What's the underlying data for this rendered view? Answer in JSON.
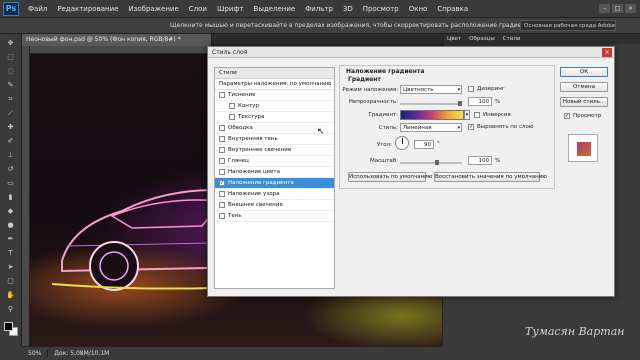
{
  "app": {
    "logo": "Ps"
  },
  "menu": [
    "Файл",
    "Редактирование",
    "Изображение",
    "Слои",
    "Шрифт",
    "Выделение",
    "Фильтр",
    "3D",
    "Просмотр",
    "Окно",
    "Справка"
  ],
  "window_controls": [
    "–",
    "□",
    "×"
  ],
  "optionsbar": {
    "hint": "Щелкните мышью и перетаскивайте в пределах изображения, чтобы скорректировать расположение градиента.",
    "workspace": "Основная рабочая среда Adobe Photoshop"
  },
  "document": {
    "tab": "Неоновый фон.psd @ 50% (Фон копия, RGB/8#) *"
  },
  "status": {
    "zoom": "50%",
    "doc": "Док: 5,08M/10,1M"
  },
  "right_panel": {
    "tabs": [
      "Цвет",
      "Образцы",
      "Стили"
    ]
  },
  "watermark": "Тумасян Вартан",
  "dialog": {
    "title": "Стиль слоя",
    "close": "×",
    "left_header": "Стили",
    "left_sub": "Параметры наложения: по умолчанию",
    "items": [
      {
        "label": "Тиснение",
        "checked": false,
        "sub": false
      },
      {
        "label": "Контур",
        "checked": false,
        "sub": true
      },
      {
        "label": "Текстура",
        "checked": false,
        "sub": true
      },
      {
        "label": "Обводка",
        "checked": false,
        "sub": false
      },
      {
        "label": "Внутренняя тень",
        "checked": false,
        "sub": false
      },
      {
        "label": "Внутреннее свечение",
        "checked": false,
        "sub": false
      },
      {
        "label": "Глянец",
        "checked": false,
        "sub": false
      },
      {
        "label": "Наложение цвета",
        "checked": false,
        "sub": false
      },
      {
        "label": "Наложение градиента",
        "checked": true,
        "sub": false,
        "selected": true
      },
      {
        "label": "Наложение узора",
        "checked": false,
        "sub": false
      },
      {
        "label": "Внешнее свечение",
        "checked": false,
        "sub": false
      },
      {
        "label": "Тень",
        "checked": false,
        "sub": false
      }
    ],
    "section_title": "Наложение градиента",
    "group_title": "Градиент",
    "blend_mode": {
      "label": "Режим наложения:",
      "value": "Цветность"
    },
    "dither": {
      "label": "Дизеринг",
      "checked": false
    },
    "opacity": {
      "label": "Непрозрачность:",
      "value": "100",
      "unit": "%",
      "level": 1.0
    },
    "gradient": {
      "label": "Градиент:"
    },
    "reverse": {
      "label": "Инверсия",
      "checked": false
    },
    "style": {
      "label": "Стиль:",
      "value": "Линейная"
    },
    "align": {
      "label": "Выровнять по слою",
      "checked": true
    },
    "angle": {
      "label": "Угол:",
      "value": "90",
      "unit": "°"
    },
    "scale": {
      "label": "Масштаб:",
      "value": "100",
      "unit": "%",
      "level": 0.6
    },
    "btn_default": "Использовать по умолчанию",
    "btn_restore": "Восстановить значения по умолчанию",
    "buttons": {
      "ok": "ОК",
      "cancel": "Отмена",
      "new_style": "Новый стиль..."
    },
    "preview": {
      "label": "Просмотр",
      "checked": true
    },
    "colors": {
      "selected": "#3b8fd9",
      "swatch": "#c9b83a"
    }
  }
}
